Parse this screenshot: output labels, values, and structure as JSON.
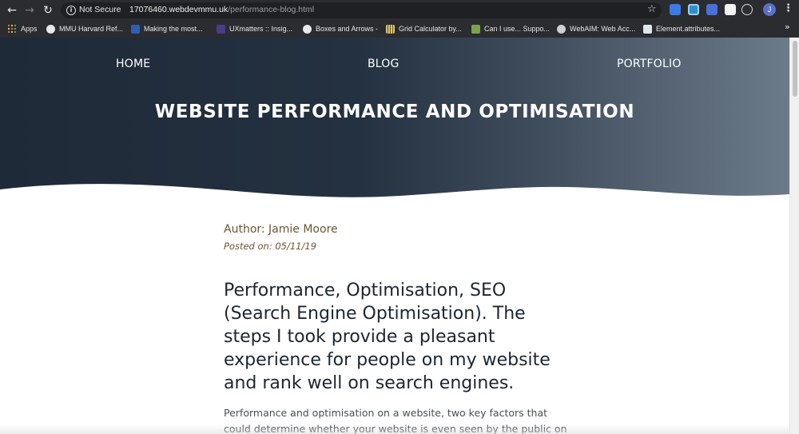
{
  "browser": {
    "security_label": "Not Secure",
    "url_host": "17076460.webdevmmu.uk",
    "url_path": "/performance-blog.html",
    "avatar_letter": "J",
    "bookmarks": [
      {
        "label": "Apps",
        "icon": "apps-grid-icon"
      },
      {
        "label": "MMU Harvard Ref...",
        "icon": "globe-icon"
      },
      {
        "label": "Making the most...",
        "icon": "word-doc-icon"
      },
      {
        "label": "UXmatters :: Insig...",
        "icon": "ux-icon"
      },
      {
        "label": "Boxes and Arrows -",
        "icon": "globe-icon"
      },
      {
        "label": "Grid Calculator by...",
        "icon": "grid-icon"
      },
      {
        "label": "Can I use... Suppo...",
        "icon": "caniuse-icon"
      },
      {
        "label": "WebAIM: Web Acc...",
        "icon": "webaim-icon"
      },
      {
        "label": "Element.attributes...",
        "icon": "mdn-icon"
      }
    ]
  },
  "site": {
    "nav": {
      "home": "HOME",
      "blog": "BLOG",
      "portfolio": "PORTFOLIO"
    },
    "hero_title": "WEBSITE PERFORMANCE AND OPTIMISATION"
  },
  "post": {
    "author": "Author: Jamie Moore",
    "posted": "Posted on: 05/11/19",
    "title": "Performance, Optimisation, SEO (Search Engine Optimisation). The steps I took provide a pleasant experience for people on my website and rank well on search engines.",
    "body": "Performance and optimisation on a website, two key factors that could determine whether your website is even seen by the public on"
  },
  "colors": {
    "hero_dark": "#1f2a38",
    "hero_light": "#6c7b89",
    "author_accent": "#6d5530",
    "title_text": "#1d2533"
  }
}
